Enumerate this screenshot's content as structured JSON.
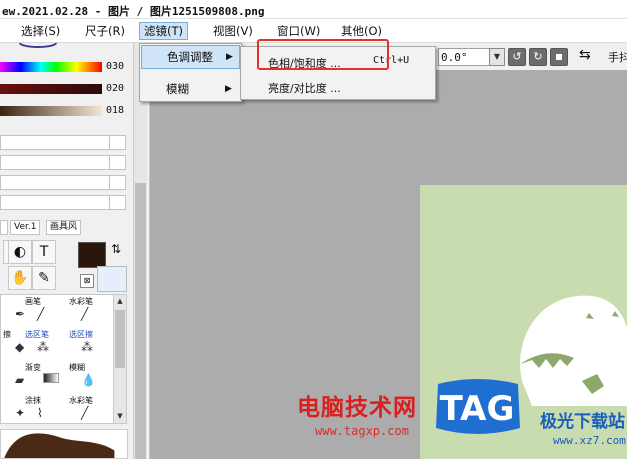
{
  "window": {
    "title": "ew.2021.02.28 - 图片 / 图片1251509808.png"
  },
  "menubar": {
    "items": [
      "选择(S)",
      "尺子(R)",
      "滤镜(T)",
      "视图(V)",
      "窗口(W)",
      "其他(O)"
    ]
  },
  "filter_menu": {
    "items": [
      {
        "label": "色调调整",
        "has_submenu": true,
        "highlighted": true
      },
      {
        "label": "模糊",
        "has_submenu": true,
        "highlighted": false
      }
    ]
  },
  "color_submenu": {
    "items": [
      {
        "label": "色相/饱和度 ...",
        "shortcut": "Ctrl+U"
      },
      {
        "label": "亮度/对比度 ..."
      }
    ]
  },
  "toolbar": {
    "angle_value": "0.0°",
    "hand_label": "手抖"
  },
  "left_panel": {
    "slider_values": [
      "030",
      "020",
      "018"
    ],
    "chips": [
      "Ver.1",
      "画具风"
    ],
    "brushes": [
      {
        "label": "",
        "icon": "pen-icon"
      },
      {
        "label": "画笔",
        "icon": "brush-icon"
      },
      {
        "label": "水彩笔",
        "icon": "watercolor-brush-icon"
      },
      {
        "label": "擦",
        "icon": "eraser-icon"
      },
      {
        "label": "选区笔",
        "icon": "selection-pen-icon"
      },
      {
        "label": "选区擦",
        "icon": "selection-eraser-icon"
      },
      {
        "label": "",
        "icon": "bucket-icon"
      },
      {
        "label": "渐变",
        "icon": "gradient-icon"
      },
      {
        "label": "模糊",
        "icon": "blur-drop-icon"
      },
      {
        "label": "",
        "icon": "marker-icon"
      },
      {
        "label": "涂抹",
        "icon": "smudge-icon"
      },
      {
        "label": "水彩笔",
        "icon": "watercolor-brush-icon"
      }
    ]
  },
  "watermark": {
    "site_name": "电脑技术网",
    "site_url": "www.tagxp.com",
    "tag": "TAG",
    "brand": "极光下载站",
    "brand_url": "www.xz7.com"
  },
  "colors": {
    "accent": "#cfe4f7",
    "highlight_box": "#e43226",
    "canvas_bg": "#c9dcaf",
    "workspace": "#acacac"
  }
}
